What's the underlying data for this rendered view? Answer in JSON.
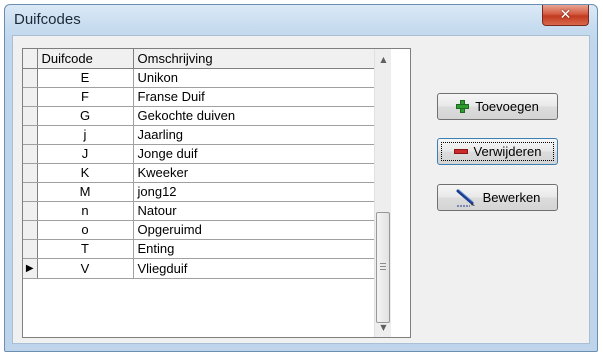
{
  "window": {
    "title": "Duifcodes",
    "close_glyph": "✕"
  },
  "grid": {
    "columns": [
      "Duifcode",
      "Omschrijving"
    ],
    "current_row_indicator": "▶",
    "rows": [
      {
        "code": "E",
        "description": "Unikon"
      },
      {
        "code": "F",
        "description": "Franse Duif"
      },
      {
        "code": "G",
        "description": "Gekochte duiven"
      },
      {
        "code": "j",
        "description": "Jaarling"
      },
      {
        "code": "J",
        "description": "Jonge duif"
      },
      {
        "code": "K",
        "description": "Kweeker"
      },
      {
        "code": "M",
        "description": "jong12"
      },
      {
        "code": "n",
        "description": "Natour"
      },
      {
        "code": "o",
        "description": "Opgeruimd"
      },
      {
        "code": "T",
        "description": "Enting"
      },
      {
        "code": "V",
        "description": "Vliegduif"
      }
    ],
    "scroll_up_glyph": "▲",
    "scroll_down_glyph": "▼"
  },
  "buttons": {
    "add_label": "Toevoegen",
    "delete_label": "Verwijderen",
    "edit_label": "Bewerken"
  },
  "colors": {
    "add_icon": "#2f9a2f",
    "delete_icon": "#cc2a2a",
    "close_button": "#c13a1f"
  },
  "icons": {
    "add": "plus-icon",
    "delete": "minus-icon",
    "edit": "pen-icon",
    "close": "close-icon"
  }
}
